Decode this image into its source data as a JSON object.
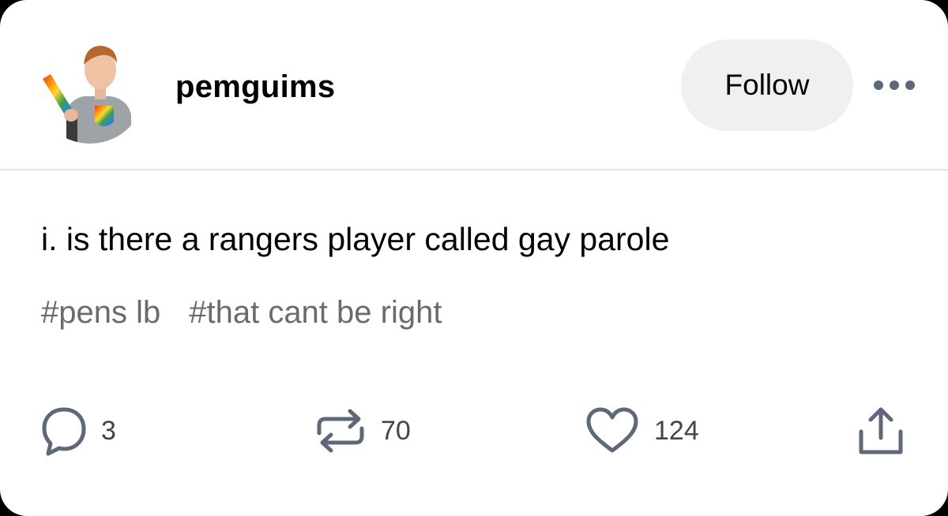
{
  "header": {
    "username": "pemguims",
    "follow_label": "Follow"
  },
  "post": {
    "text": "i. is there a rangers player called gay parole",
    "tags": [
      "#pens lb",
      "#that cant be right"
    ]
  },
  "actions": {
    "replies": "3",
    "reblogs": "70",
    "likes": "124"
  },
  "icons": {
    "more": "more-dots-icon",
    "reply": "speech-bubble-icon",
    "reblog": "repost-arrows-icon",
    "like": "heart-icon",
    "share": "share-icon"
  },
  "colors": {
    "icon": "#5e6878",
    "follow_bg": "#f0f0f2",
    "tag_text": "#6b6b6b",
    "divider": "#e2e2e6"
  }
}
